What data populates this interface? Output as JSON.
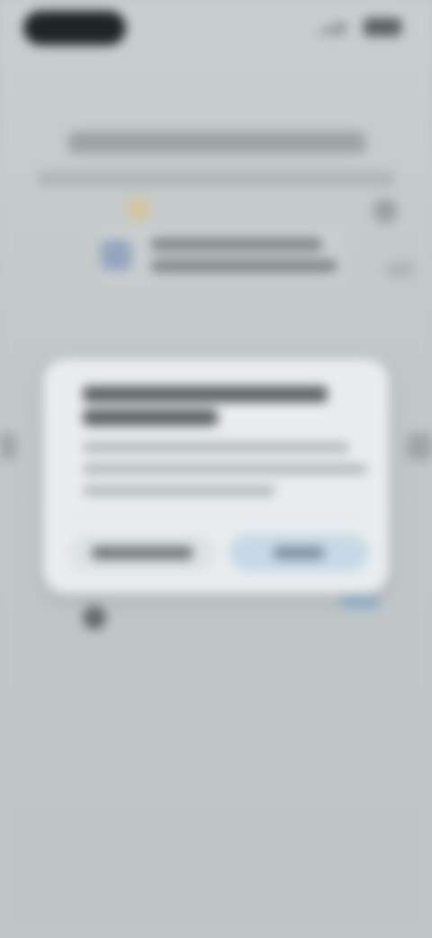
{
  "status_bar": {
    "time": "",
    "icons": [
      "signal-icon",
      "battery-icon"
    ]
  },
  "page": {
    "title": "",
    "subtitle": "",
    "banner": {
      "icon": "document-icon",
      "line1": "",
      "line2": ""
    },
    "icons": [
      "sparkle-icon",
      "help-icon"
    ]
  },
  "dialog": {
    "title": "",
    "body": "",
    "buttons": {
      "secondary_label": "",
      "primary_label": ""
    }
  },
  "colors": {
    "background": "#c1c7c7",
    "dialog_background": "#e9edef",
    "primary_button": "#c7d9e6",
    "secondary_button": "#dde2e4"
  }
}
